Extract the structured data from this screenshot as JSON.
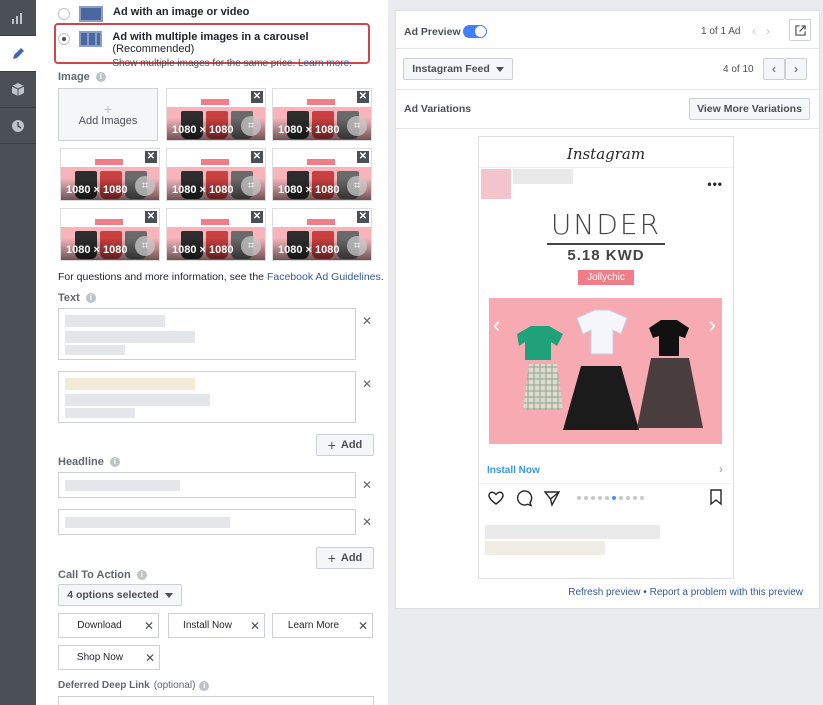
{
  "rail": {
    "icons": [
      "bar-chart-icon",
      "pencil-icon",
      "cube-icon",
      "clock-icon"
    ]
  },
  "format": {
    "single_label": "Ad with an image or video",
    "carousel_label": "Ad with multiple images in a carousel",
    "carousel_badge": "(Recommended)",
    "carousel_desc": "Show multiple images for the same price.",
    "carousel_link": "Learn more."
  },
  "image": {
    "label": "Image",
    "add_label": "Add Images",
    "thumb_size": "1080 × 1080",
    "remove_glyph": "✕",
    "crop_glyph": "⌗"
  },
  "guidelines": {
    "prefix": "For questions and more information, see the",
    "link": "Facebook Ad Guidelines",
    "suffix": "."
  },
  "text": {
    "label": "Text",
    "add_label": "Add"
  },
  "headline": {
    "label": "Headline",
    "add_label": "Add"
  },
  "cta": {
    "label": "Call To Action",
    "selector": "4 options selected",
    "options": [
      "Download",
      "Install Now",
      "Learn More",
      "Shop Now"
    ]
  },
  "deferred": {
    "label": "Deferred Deep Link",
    "optional": "(optional)"
  },
  "preview": {
    "title": "Ad Preview",
    "ad_count": "1 of 1 Ad",
    "feed": "Instagram Feed",
    "page_count": "4 of 10",
    "variations_label": "Ad Variations",
    "view_more": "View More Variations",
    "ig_brand": "Instagram",
    "headline_big": "UNDER",
    "price": "5.18 KWD",
    "brand_tag": "Jollychic",
    "install_now": "Install Now",
    "refresh": "Refresh preview",
    "separator": "•",
    "report": "Report a problem with this preview"
  },
  "colors": {
    "accent": "#4080ff",
    "link": "#365899",
    "highlight_border": "#d0454b",
    "ad_pink": "#f7aab1",
    "tag_pink": "#f07d88"
  }
}
